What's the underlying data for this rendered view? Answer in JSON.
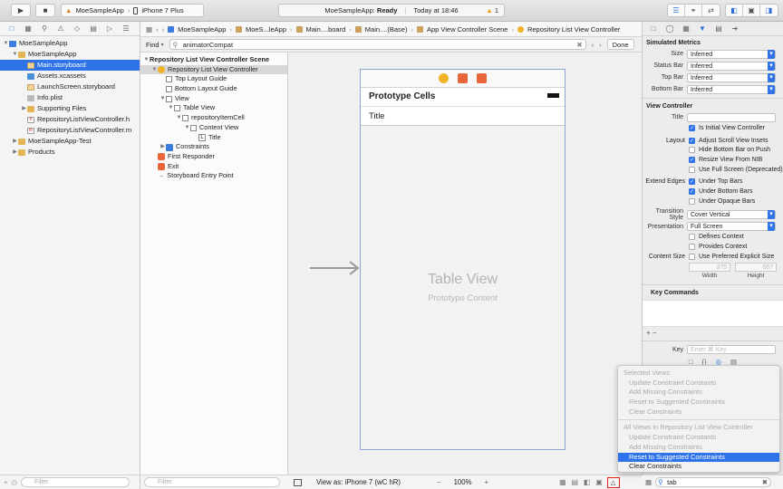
{
  "toolbar": {
    "scheme_app": "MoeSampleApp",
    "scheme_device": "iPhone 7 Plus",
    "activity_app": "MoeSampleApp:",
    "activity_status": "Ready",
    "activity_time": "Today at 18:46",
    "warning_count": "1"
  },
  "navigator": {
    "items": [
      {
        "label": "MoeSampleApp",
        "depth": 0,
        "kind": "project",
        "disc": "▼"
      },
      {
        "label": "MoeSampleApp",
        "depth": 1,
        "kind": "folder",
        "disc": "▼"
      },
      {
        "label": "Main.storyboard",
        "depth": 2,
        "kind": "sb",
        "selected": true
      },
      {
        "label": "Assets.xcassets",
        "depth": 2,
        "kind": "assets"
      },
      {
        "label": "LaunchScreen.storyboard",
        "depth": 2,
        "kind": "sb"
      },
      {
        "label": "Info.plist",
        "depth": 2,
        "kind": "plist"
      },
      {
        "label": "Supporting Files",
        "depth": 2,
        "kind": "folder",
        "disc": "▶"
      },
      {
        "label": "RepositoryListViewController.h",
        "depth": 2,
        "kind": "hfile"
      },
      {
        "label": "RepositoryListViewController.m",
        "depth": 2,
        "kind": "mfile"
      },
      {
        "label": "MoeSampleApp-Test",
        "depth": 1,
        "kind": "folder",
        "disc": "▶"
      },
      {
        "label": "Products",
        "depth": 1,
        "kind": "folder",
        "disc": "▶"
      }
    ],
    "filter_placeholder": "Filter"
  },
  "jumpbar": {
    "crumbs": [
      "MoeSampleApp",
      "MoeS...leApp",
      "Main....board",
      "Main....(Base)",
      "App View Controller Scene",
      "Repository List View Controller"
    ]
  },
  "findbar": {
    "mode": "Find",
    "query": "animatorCompat",
    "done_label": "Done"
  },
  "outline": {
    "items": [
      {
        "label": "Repository List View Controller Scene",
        "depth": 0,
        "kind": "scene",
        "disc": "▼"
      },
      {
        "label": "Repository List View Controller",
        "depth": 1,
        "kind": "circle",
        "disc": "▼",
        "selected": true
      },
      {
        "label": "Top Layout Guide",
        "depth": 2,
        "kind": "box"
      },
      {
        "label": "Bottom Layout Guide",
        "depth": 2,
        "kind": "box"
      },
      {
        "label": "View",
        "depth": 2,
        "kind": "box",
        "disc": "▼"
      },
      {
        "label": "Table View",
        "depth": 3,
        "kind": "box",
        "disc": "▼"
      },
      {
        "label": "repositoryItemCell",
        "depth": 4,
        "kind": "box",
        "disc": "▼"
      },
      {
        "label": "Content View",
        "depth": 5,
        "kind": "box",
        "disc": "▼"
      },
      {
        "label": "Title",
        "depth": 6,
        "kind": "label"
      },
      {
        "label": "Constraints",
        "depth": 2,
        "kind": "blue",
        "disc": "▶"
      },
      {
        "label": "First Responder",
        "depth": 1,
        "kind": "red"
      },
      {
        "label": "Exit",
        "depth": 1,
        "kind": "red"
      },
      {
        "label": "Storyboard Entry Point",
        "depth": 1,
        "kind": "arrow"
      }
    ],
    "filter_placeholder": "Filter"
  },
  "scene": {
    "prototype_header": "Prototype Cells",
    "cell_title": "Title",
    "table_title": "Table View",
    "table_subtitle": "Prototype Content"
  },
  "canvasbar": {
    "view_as": "View as: iPhone 7 (wC hR)",
    "zoom": "100%"
  },
  "inspector": {
    "simulated_metrics": {
      "heading": "Simulated Metrics",
      "rows": [
        {
          "label": "Size",
          "value": "Inferred"
        },
        {
          "label": "Status Bar",
          "value": "Inferred"
        },
        {
          "label": "Top Bar",
          "value": "Inferred"
        },
        {
          "label": "Bottom Bar",
          "value": "Inferred"
        }
      ]
    },
    "view_controller": {
      "heading": "View Controller",
      "title_label": "Title",
      "initial_label": "Is Initial View Controller",
      "layout_label": "Layout",
      "layout_options": [
        {
          "label": "Adjust Scroll View Insets",
          "checked": true
        },
        {
          "label": "Hide Bottom Bar on Push",
          "checked": false
        },
        {
          "label": "Resize View From NIB",
          "checked": true
        },
        {
          "label": "Use Full Screen (Deprecated)",
          "checked": false
        }
      ],
      "extend_label": "Extend Edges",
      "extend_options": [
        {
          "label": "Under Top Bars",
          "checked": true
        },
        {
          "label": "Under Bottom Bars",
          "checked": true
        },
        {
          "label": "Under Opaque Bars",
          "checked": false
        }
      ],
      "transition_label": "Transition Style",
      "transition_value": "Cover Vertical",
      "presentation_label": "Presentation",
      "presentation_value": "Full Screen",
      "defines_context": "Defines Context",
      "provides_context": "Provides Context",
      "content_size_label": "Content Size",
      "content_size_option": "Use Preferred Explicit Size",
      "width_value": "375",
      "height_value": "667",
      "width_label": "Width",
      "height_label": "Height"
    },
    "key_commands": {
      "heading": "Key Commands",
      "key_label": "Key",
      "key_placeholder": "Enter ⌘ Key"
    },
    "library_filter": "tab"
  },
  "resolve_menu": {
    "selected_views_heading": "Selected Views",
    "selected_items": [
      "Update Constraint Constants",
      "Add Missing Constraints",
      "Reset to Suggested Constraints",
      "Clear Constraints"
    ],
    "all_views_heading": "All Views in Repository List View Controller",
    "all_items": [
      {
        "label": "Update Constraint Constants",
        "state": "disabled"
      },
      {
        "label": "Add Missing Constraints",
        "state": "disabled"
      },
      {
        "label": "Reset to Suggested Constraints",
        "state": "selected"
      },
      {
        "label": "Clear Constraints",
        "state": "enabled"
      }
    ]
  }
}
